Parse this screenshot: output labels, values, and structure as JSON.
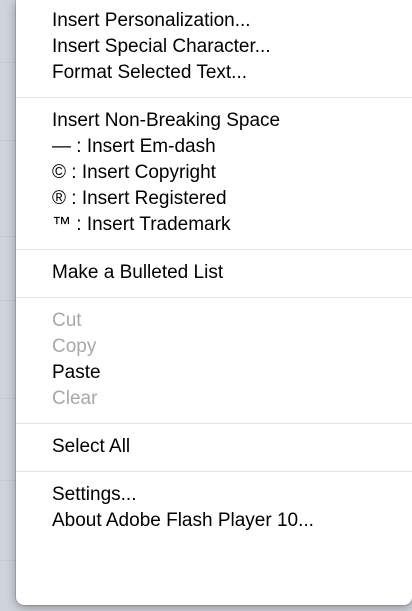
{
  "colors": {
    "menu_background": "#ffffff",
    "enabled_text": "#000000",
    "disabled_text": "#a8a8a8",
    "separator": "#e3e3e3"
  },
  "menu": {
    "sections": [
      {
        "items": [
          {
            "label": "Insert Personalization...",
            "enabled": true
          },
          {
            "label": "Insert Special Character...",
            "enabled": true
          },
          {
            "label": "Format Selected Text...",
            "enabled": true
          }
        ]
      },
      {
        "items": [
          {
            "label": "Insert Non-Breaking Space",
            "enabled": true
          },
          {
            "label": "— : Insert Em-dash",
            "enabled": true
          },
          {
            "label": "© : Insert Copyright",
            "enabled": true
          },
          {
            "label": "® : Insert Registered",
            "enabled": true
          },
          {
            "label": "™ : Insert Trademark",
            "enabled": true
          }
        ]
      },
      {
        "items": [
          {
            "label": "Make a Bulleted List",
            "enabled": true
          }
        ]
      },
      {
        "items": [
          {
            "label": "Cut",
            "enabled": false
          },
          {
            "label": "Copy",
            "enabled": false
          },
          {
            "label": "Paste",
            "enabled": true
          },
          {
            "label": "Clear",
            "enabled": false
          }
        ]
      },
      {
        "items": [
          {
            "label": "Select All",
            "enabled": true
          }
        ]
      },
      {
        "items": [
          {
            "label": "Settings...",
            "enabled": true
          },
          {
            "label": "About Adobe Flash Player 10...",
            "enabled": true
          }
        ]
      }
    ]
  }
}
